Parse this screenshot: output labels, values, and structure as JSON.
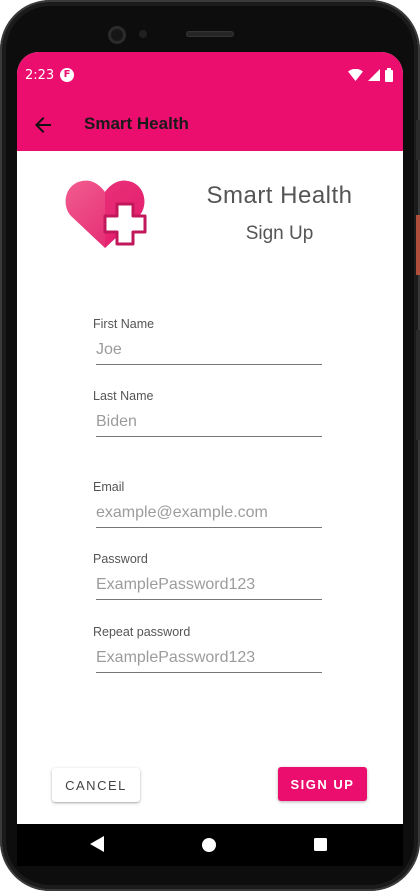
{
  "status_bar": {
    "time": "2:23",
    "app_icon_glyph": "F",
    "icons": [
      "wifi-icon",
      "signal-icon",
      "battery-icon"
    ]
  },
  "app_bar": {
    "title": "Smart Health",
    "back_icon": "arrow-left-icon"
  },
  "brand": {
    "title": "Smart Health",
    "subtitle": "Sign Up",
    "logo_icon": "heart-plus-icon"
  },
  "form": {
    "first_name": {
      "label": "First Name",
      "placeholder": "Joe"
    },
    "last_name": {
      "label": "Last Name",
      "placeholder": "Biden"
    },
    "email": {
      "label": "Email",
      "placeholder": "example@example.com"
    },
    "password": {
      "label": "Password",
      "placeholder": "ExamplePassword123"
    },
    "repeat_password": {
      "label": "Repeat password",
      "placeholder": "ExamplePassword123"
    }
  },
  "actions": {
    "cancel_label": "CANCEL",
    "signup_label": "SIGN UP"
  },
  "nav": {
    "icons": [
      "back-triangle-icon",
      "home-circle-icon",
      "recents-square-icon"
    ]
  },
  "colors": {
    "accent": "#eb0e6e",
    "logo_light": "#f25c8f",
    "logo_dark": "#c2185b"
  }
}
